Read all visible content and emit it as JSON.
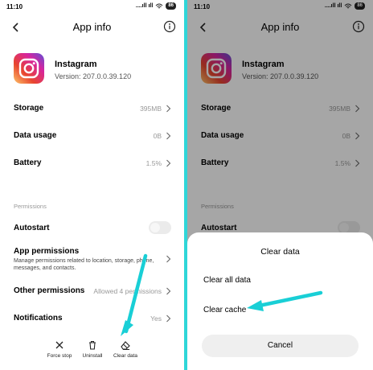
{
  "status_bar": {
    "time": "11:10",
    "signal_text": "....ıll ıll",
    "battery": "86"
  },
  "header": {
    "title": "App info"
  },
  "app": {
    "name": "Instagram",
    "version": "Version: 207.0.0.39.120"
  },
  "rows": {
    "storage": {
      "label": "Storage",
      "value": "395MB"
    },
    "data_usage": {
      "label": "Data usage",
      "value": "0B"
    },
    "battery": {
      "label": "Battery",
      "value": "1.5%"
    }
  },
  "permissions": {
    "section_title": "Permissions",
    "autostart": {
      "label": "Autostart"
    },
    "app_permissions": {
      "label": "App permissions",
      "description": "Manage permissions related to location, storage, phone, messages, and contacts."
    },
    "other_permissions": {
      "label": "Other permissions",
      "value": "Allowed 4 permissions"
    },
    "notifications": {
      "label": "Notifications",
      "value": "Yes"
    }
  },
  "bottom_actions": {
    "force_stop": "Force stop",
    "uninstall": "Uninstall",
    "clear_data": "Clear data"
  },
  "dialog": {
    "title": "Clear data",
    "option_clear_all": "Clear all data",
    "option_clear_cache": "Clear cache",
    "cancel": "Cancel"
  },
  "colors": {
    "divider": "#2fd6d8",
    "arrow": "#19cfd6",
    "overlay": "rgba(0,0,0,0.35)"
  },
  "icons": {
    "back": "back-arrow-icon",
    "info": "info-icon",
    "chevron": "chevron-right-icon",
    "force_stop": "close-icon",
    "uninstall": "trash-icon",
    "clear_data": "eraser-icon",
    "wifi": "wifi-icon",
    "battery": "battery-icon"
  }
}
